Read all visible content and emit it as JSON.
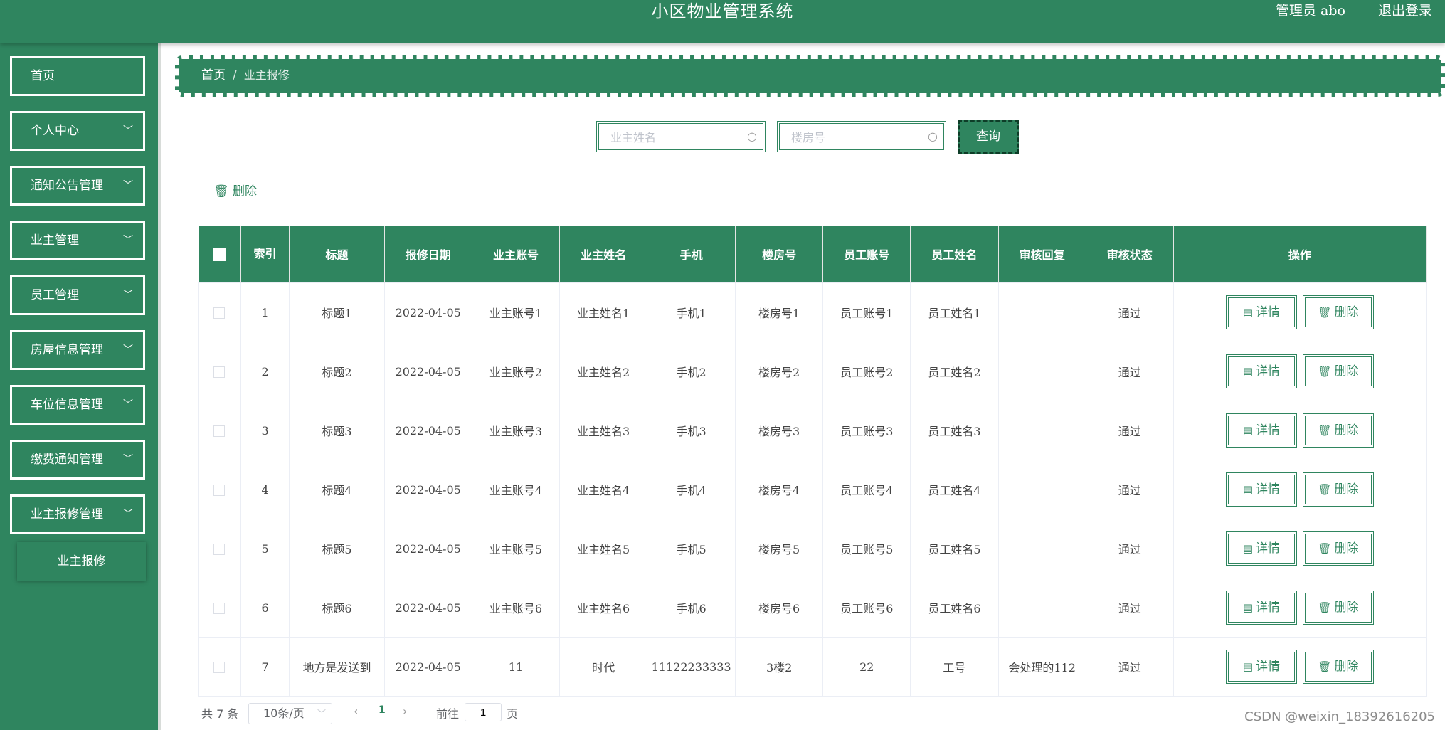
{
  "header": {
    "title": "小区物业管理系统",
    "user_label": "管理员 abo",
    "logout": "退出登录"
  },
  "sidebar": {
    "items": [
      {
        "label": "首页",
        "expandable": false
      },
      {
        "label": "个人中心",
        "expandable": true
      },
      {
        "label": "通知公告管理",
        "expandable": true
      },
      {
        "label": "业主管理",
        "expandable": true
      },
      {
        "label": "员工管理",
        "expandable": true
      },
      {
        "label": "房屋信息管理",
        "expandable": true
      },
      {
        "label": "车位信息管理",
        "expandable": true
      },
      {
        "label": "缴费通知管理",
        "expandable": true
      },
      {
        "label": "业主报修管理",
        "expandable": true
      }
    ],
    "sub_item": "业主报修"
  },
  "breadcrumb": {
    "home": "首页",
    "sep": "/",
    "current": "业主报修"
  },
  "search": {
    "name_placeholder": "业主姓名",
    "building_placeholder": "楼房号",
    "query_button": "查询"
  },
  "toolbar": {
    "delete_label": "删除"
  },
  "table": {
    "headers": [
      "索引",
      "标题",
      "报修日期",
      "业主账号",
      "业主姓名",
      "手机",
      "楼房号",
      "员工账号",
      "员工姓名",
      "审核回复",
      "审核状态",
      "操作"
    ],
    "rows": [
      [
        "1",
        "标题1",
        "2022-04-05",
        "业主账号1",
        "业主姓名1",
        "手机1",
        "楼房号1",
        "员工账号1",
        "员工姓名1",
        "",
        "通过"
      ],
      [
        "2",
        "标题2",
        "2022-04-05",
        "业主账号2",
        "业主姓名2",
        "手机2",
        "楼房号2",
        "员工账号2",
        "员工姓名2",
        "",
        "通过"
      ],
      [
        "3",
        "标题3",
        "2022-04-05",
        "业主账号3",
        "业主姓名3",
        "手机3",
        "楼房号3",
        "员工账号3",
        "员工姓名3",
        "",
        "通过"
      ],
      [
        "4",
        "标题4",
        "2022-04-05",
        "业主账号4",
        "业主姓名4",
        "手机4",
        "楼房号4",
        "员工账号4",
        "员工姓名4",
        "",
        "通过"
      ],
      [
        "5",
        "标题5",
        "2022-04-05",
        "业主账号5",
        "业主姓名5",
        "手机5",
        "楼房号5",
        "员工账号5",
        "员工姓名5",
        "",
        "通过"
      ],
      [
        "6",
        "标题6",
        "2022-04-05",
        "业主账号6",
        "业主姓名6",
        "手机6",
        "楼房号6",
        "员工账号6",
        "员工姓名6",
        "",
        "通过"
      ],
      [
        "7",
        "地方是发送到",
        "2022-04-05",
        "11",
        "时代",
        "11122233333",
        "3楼2",
        "22",
        "工号",
        "会处理的112",
        "通过"
      ]
    ],
    "detail_button": "详情",
    "delete_button": "删除"
  },
  "pagination": {
    "total": "共 7 条",
    "page_size": "10条/页",
    "current_page": "1",
    "goto_prefix": "前往",
    "goto_value": "1",
    "goto_suffix": "页"
  },
  "watermark": "CSDN @weixin_18392616205",
  "colors": {
    "primary": "#2f855f",
    "dark_accent": "#0e3d28"
  }
}
